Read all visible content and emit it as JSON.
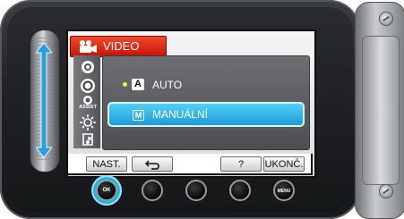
{
  "menu": {
    "title": "VIDEO",
    "title_icon": "movie-camera-icon",
    "side_icons": [
      "scene-icon",
      "focus-icon",
      "assist-icon",
      "brightness-icon",
      "white-balance-icon"
    ],
    "assist_text": "ASSIST",
    "options": [
      {
        "badge": "A",
        "label": "AUTO",
        "selected": true
      },
      {
        "badge": "M",
        "label": "MANUÁLNÍ",
        "highlighted": true
      }
    ]
  },
  "softkeys": {
    "settings": "NAST.",
    "back_icon": "return-arrow-icon",
    "help": "?",
    "exit": "UKONČ."
  },
  "buttons": {
    "ok": "OK",
    "menu": "MENU"
  },
  "colors": {
    "title_bar": "#e02a16",
    "highlight": "#2fb0e6",
    "ok_ring": "#1fb5e0",
    "selected_dot": "#f8ef3a"
  }
}
